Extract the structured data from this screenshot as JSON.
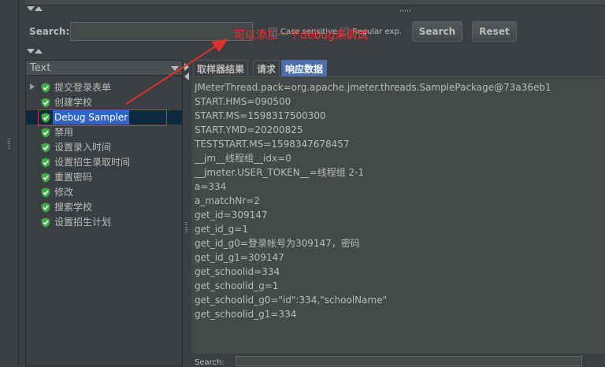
{
  "search": {
    "label": "Search:",
    "value": "",
    "case_label": "Case sensitive",
    "regex_label": "Regular exp.",
    "search_button": "Search",
    "reset_button": "Reset"
  },
  "tree": {
    "header": "Text",
    "items": [
      {
        "label": "提交登录表单",
        "expandable": true
      },
      {
        "label": "创建学校"
      },
      {
        "label": "Debug Sampler",
        "selected": true
      },
      {
        "label": "禁用"
      },
      {
        "label": "设置录入时间"
      },
      {
        "label": "设置招生录取时间"
      },
      {
        "label": "重置密码"
      },
      {
        "label": "修改"
      },
      {
        "label": "搜索学校"
      },
      {
        "label": "设置招生计划"
      }
    ]
  },
  "tabs": [
    {
      "label": "取样器结果"
    },
    {
      "label": "请求"
    },
    {
      "label": "响应数据",
      "active": true
    }
  ],
  "response_lines": [
    "JMeterThread.pack=org.apache.jmeter.threads.SamplePackage@73a36eb1",
    "START.HMS=090500",
    "START.MS=1598317500300",
    "START.YMD=20200825",
    "TESTSTART.MS=1598347678457",
    "__jm__线程组__idx=0",
    "__jmeter.USER_TOKEN__=线程组 2-1",
    "a=334",
    "a_matchNr=2",
    "get_id=309147",
    "get_id_g=1",
    "get_id_g0=登录帐号为309147，密码",
    "get_id_g1=309147",
    "get_schoolid=334",
    "get_schoolid_g=1",
    "get_schoolid_g0=\"id\":334,\"schoolName\"",
    "get_schoolid_g1=334"
  ],
  "bottom": {
    "label": "Search:"
  },
  "annotation": {
    "text": "可以添加一个debug来调试"
  },
  "colors": {
    "background": "#3c3f41",
    "panel": "#45494a",
    "active_tab": "#4b6eaf",
    "selection": "#2f65ca",
    "annotation": "#e0312b",
    "shield_green": "#3fae49"
  }
}
